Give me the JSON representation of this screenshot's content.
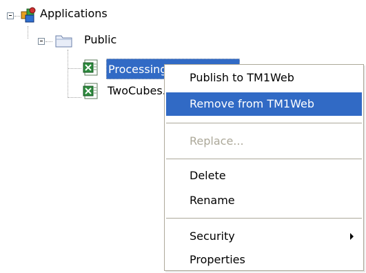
{
  "tree": {
    "root": {
      "label": "Applications",
      "icon": "applications-icon"
    },
    "folder": {
      "label": "Public",
      "icon": "folder-icon"
    },
    "items": [
      {
        "label": "ProcessingPrice.xls",
        "icon": "excel-file-icon",
        "selected": true
      },
      {
        "label": "TwoCubes.xls",
        "icon": "excel-file-icon",
        "selected": false
      }
    ]
  },
  "context_menu": {
    "items": [
      {
        "label": "Publish to TM1Web",
        "state": "normal"
      },
      {
        "label": "Remove from TM1Web",
        "state": "highlighted"
      },
      {
        "label": "Replace...",
        "state": "disabled"
      },
      {
        "label": "Delete",
        "state": "normal"
      },
      {
        "label": "Rename",
        "state": "normal"
      },
      {
        "label": "Security",
        "state": "normal",
        "submenu": true
      },
      {
        "label": "Properties",
        "state": "normal"
      }
    ]
  },
  "colors": {
    "selection": "#316ac5",
    "menu_border": "#aca899",
    "disabled_text": "#aca899"
  }
}
